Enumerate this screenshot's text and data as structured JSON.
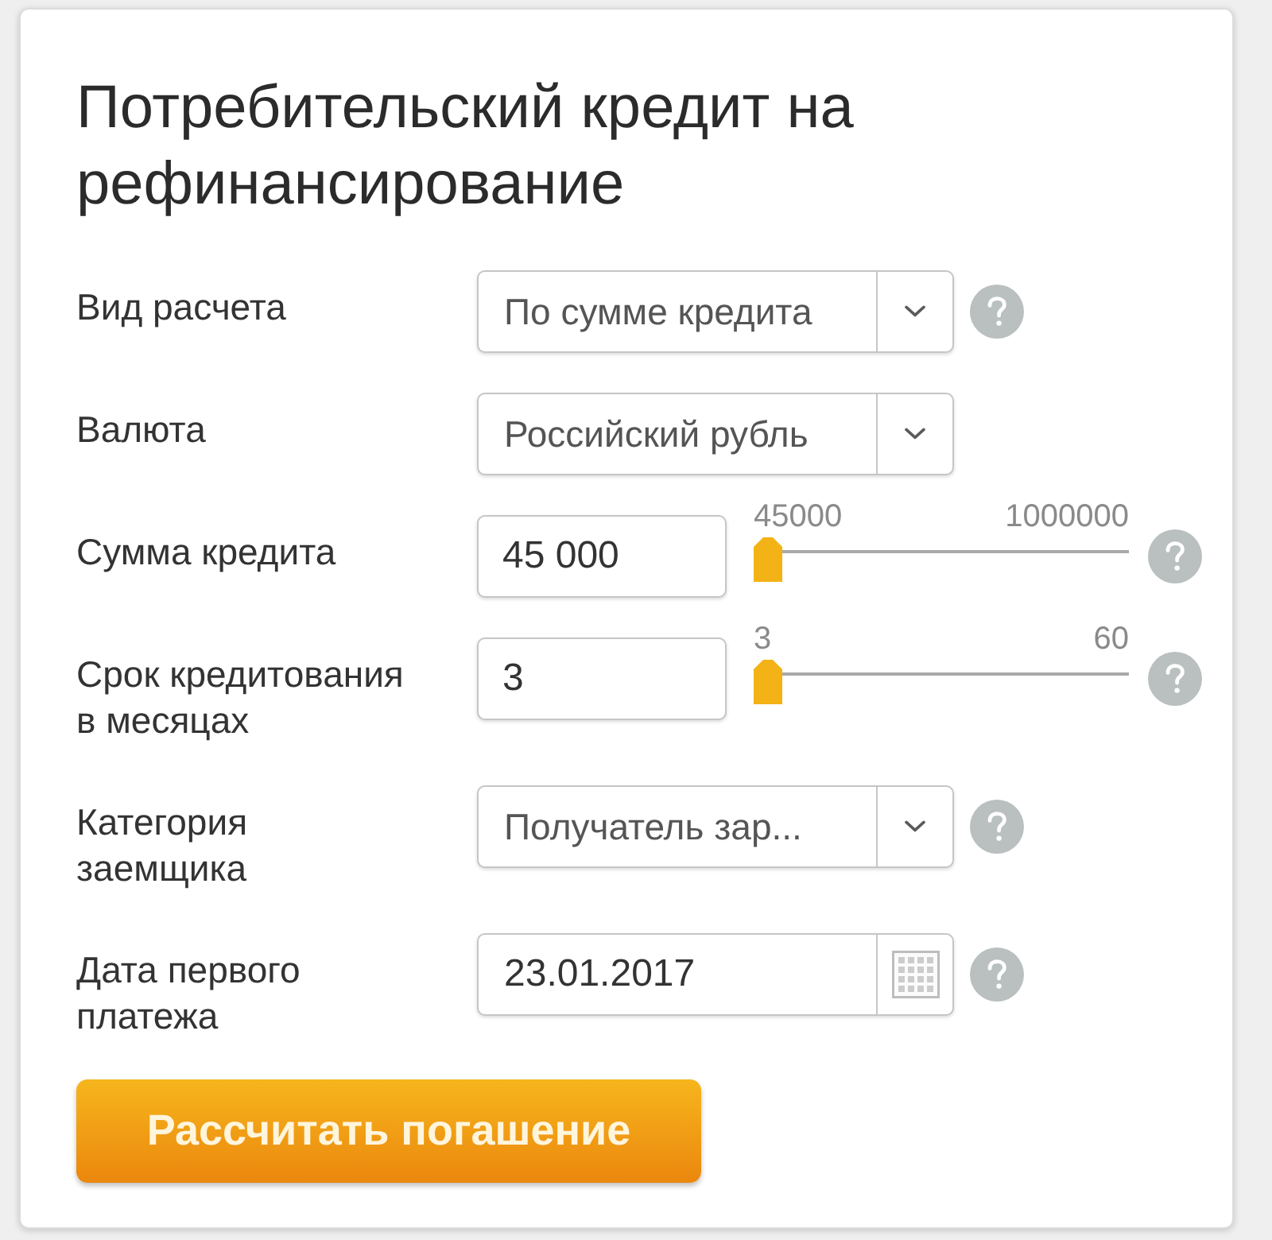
{
  "title": "Потребительский кредит на рефинансирование",
  "fields": [
    {
      "kind": "select",
      "label": "Вид расчета",
      "value": "По сумме кредита",
      "help": true
    },
    {
      "kind": "select",
      "label": "Валюта",
      "value": "Российский рубль",
      "help": false
    },
    {
      "kind": "slider",
      "label": "Сумма кредита",
      "value": "45 000",
      "min_label": "45000",
      "max_label": "1000000",
      "level": 0,
      "help": true
    },
    {
      "kind": "slider",
      "label": "Срок кредитования в месяцах",
      "value": "3",
      "min_label": "3",
      "max_label": "60",
      "level": 0,
      "help": true
    },
    {
      "kind": "select",
      "label": "Категория заемщика",
      "value": "Получатель зар...",
      "help": true
    },
    {
      "kind": "date",
      "label": "Дата первого платежа",
      "value": "23.01.2017",
      "help": true
    }
  ],
  "button": {
    "label": "Рассчитать погашение"
  }
}
